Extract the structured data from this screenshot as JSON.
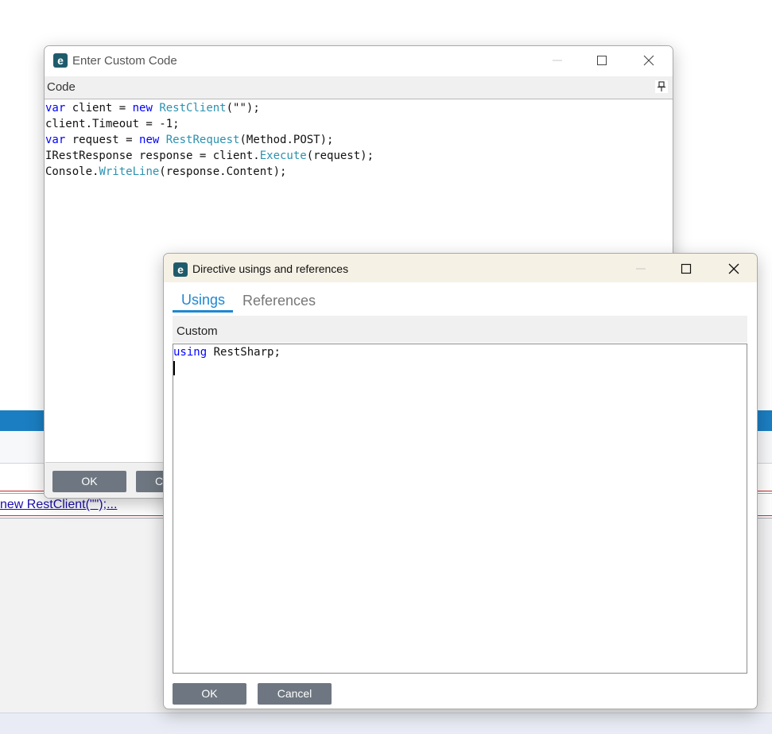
{
  "background": {
    "link_text": "new RestClient(\"\");..."
  },
  "custom_code_window": {
    "title": "Enter Custom Code",
    "section_label": "Code",
    "code_lines": [
      [
        {
          "t": "var",
          "c": "kw"
        },
        {
          "t": " client = ",
          "c": ""
        },
        {
          "t": "new",
          "c": "kw"
        },
        {
          "t": " ",
          "c": ""
        },
        {
          "t": "RestClient",
          "c": "ty"
        },
        {
          "t": "(\"\");",
          "c": ""
        }
      ],
      [
        {
          "t": "client.Timeout = -1;",
          "c": ""
        }
      ],
      [
        {
          "t": "var",
          "c": "kw"
        },
        {
          "t": " request = ",
          "c": ""
        },
        {
          "t": "new",
          "c": "kw"
        },
        {
          "t": " ",
          "c": ""
        },
        {
          "t": "RestRequest",
          "c": "ty"
        },
        {
          "t": "(Method.POST);",
          "c": ""
        }
      ],
      [
        {
          "t": "IRestResponse response = client.",
          "c": ""
        },
        {
          "t": "Execute",
          "c": "ty"
        },
        {
          "t": "(request);",
          "c": ""
        }
      ],
      [
        {
          "t": "Console.",
          "c": ""
        },
        {
          "t": "WriteLine",
          "c": "ty"
        },
        {
          "t": "(response.Content);",
          "c": ""
        }
      ]
    ],
    "ok_label": "OK",
    "cancel_label_visible": "C"
  },
  "usings_window": {
    "title": "Directive usings and references",
    "tabs": [
      {
        "label": "Usings",
        "active": true
      },
      {
        "label": "References",
        "active": false
      }
    ],
    "section_label": "Custom",
    "code_keyword": "using",
    "code_rest": " RestSharp;",
    "ok_label": "OK",
    "cancel_label": "Cancel"
  },
  "colors": {
    "keyword": "#0000ff",
    "type": "#2b91af",
    "tab_active": "#1f87d1",
    "button_bg": "#6e7781"
  }
}
